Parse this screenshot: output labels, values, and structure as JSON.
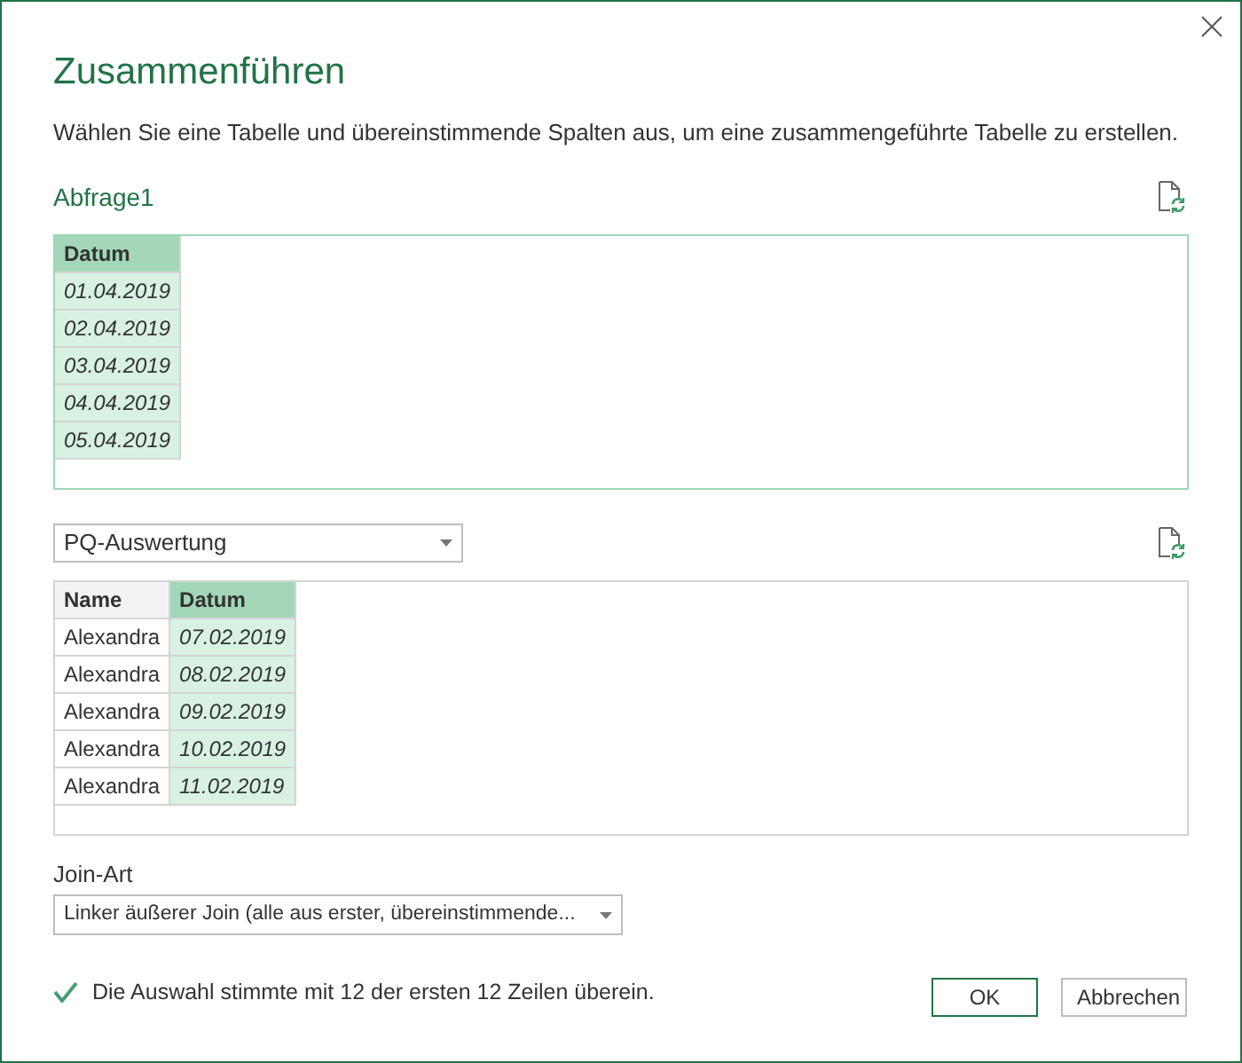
{
  "dialog": {
    "title": "Zusammenführen",
    "description": "Wählen Sie eine Tabelle und übereinstimmende Spalten aus, um eine zusammengeführte Tabelle zu erstellen."
  },
  "tables": [
    {
      "source": {
        "kind": "label",
        "text": "Abfrage1"
      },
      "active": true,
      "columns": [
        {
          "name": "Datum",
          "selected": true
        }
      ],
      "rows": [
        [
          "01.04.2019"
        ],
        [
          "02.04.2019"
        ],
        [
          "03.04.2019"
        ],
        [
          "04.04.2019"
        ],
        [
          "05.04.2019"
        ]
      ]
    },
    {
      "source": {
        "kind": "dropdown",
        "text": "PQ-Auswertung"
      },
      "active": false,
      "columns": [
        {
          "name": "Name",
          "selected": false
        },
        {
          "name": "Datum",
          "selected": true
        }
      ],
      "rows": [
        [
          "Alexandra",
          "07.02.2019"
        ],
        [
          "Alexandra",
          "08.02.2019"
        ],
        [
          "Alexandra",
          "09.02.2019"
        ],
        [
          "Alexandra",
          "10.02.2019"
        ],
        [
          "Alexandra",
          "11.02.2019"
        ]
      ]
    }
  ],
  "join": {
    "label": "Join-Art",
    "value": "Linker äußerer Join (alle aus erster, übereinstimmende..."
  },
  "status": {
    "ok": true,
    "text": "Die Auswahl stimmte mit 12 der ersten 12 Zeilen überein."
  },
  "buttons": [
    {
      "label": "OK",
      "default": true
    },
    {
      "label": "Abbrechen",
      "default": false
    }
  ]
}
